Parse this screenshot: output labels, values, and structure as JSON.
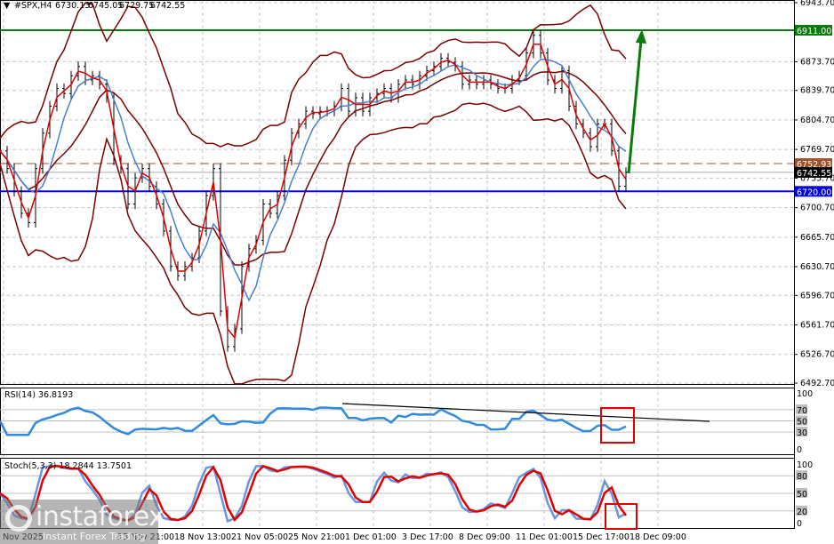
{
  "header": {
    "symbol": "#SPX,H4",
    "open": "6730.13",
    "high": "6745.05",
    "low": "6729.75",
    "close": "6742.55"
  },
  "colors": {
    "bull_bear_bars": "#000000",
    "fast_ma": "#e00000",
    "slow_ma": "#4a7fd0",
    "bands": "#7a0000",
    "resistance": "#0a7a0a",
    "support": "#0000e0",
    "level_brown": "#a0522d",
    "rsi": "#2f8ae0",
    "stoch_main": "#6a95e0",
    "stoch_signal": "#e00000",
    "highlight_box": "#e00000",
    "arrow": "#0a7a0a"
  },
  "levels": {
    "resistance": {
      "value": 6911.0,
      "label": "6911.00"
    },
    "support": {
      "value": 6720.0,
      "label": "6720.00"
    },
    "brown": {
      "value": 6752.93,
      "label": "6752.93"
    },
    "current": {
      "value": 6742.55,
      "label": "6742.55"
    }
  },
  "indicators": {
    "rsi_label": "RSI(14) 36.8193",
    "stoch_label": "Stoch(5,3,3) 18.2844 13.7501",
    "rsi_ticks": [
      "100",
      "70",
      "50",
      "30",
      "0"
    ],
    "stoch_ticks": [
      "100",
      "80",
      "50",
      "20",
      "0"
    ]
  },
  "logo": {
    "name": "instaforex",
    "tagline": "Instant Forex Trading"
  },
  "chart_data": {
    "type": "line",
    "title": "#SPX,H4",
    "ylim": [
      6492.7,
      6943.7
    ],
    "y_ticks": [
      "6943.70",
      "6873.70",
      "6839.70",
      "6804.70",
      "6769.70",
      "6735.70",
      "6700.70",
      "6665.70",
      "6630.70",
      "6596.70",
      "6561.70",
      "6526.70",
      "6492.70"
    ],
    "x_ticks": [
      "6 Nov 2025",
      "13 Nov 21:00",
      "18 Nov 13:00",
      "21 Nov 05:00",
      "25 Nov 21:00",
      "1 Dec 01:00",
      "3 Dec 17:00",
      "8 Dec 09:00",
      "11 Dec 01:00",
      "15 Dec 17:00",
      "18 Dec 09:00"
    ],
    "series": [
      {
        "name": "close",
        "values": [
          6768,
          6747,
          6720,
          6694,
          6683,
          6747,
          6789,
          6821,
          6842,
          6836,
          6857,
          6868,
          6852,
          6857,
          6847,
          6831,
          6757,
          6747,
          6705,
          6736,
          6747,
          6726,
          6705,
          6673,
          6631,
          6620,
          6631,
          6641,
          6673,
          6715,
          6747,
          6578,
          6536,
          6557,
          6631,
          6652,
          6662,
          6705,
          6694,
          6715,
          6757,
          6789,
          6800,
          6815,
          6812,
          6815,
          6815,
          6821,
          6842,
          6815,
          6831,
          6815,
          6831,
          6836,
          6842,
          6831,
          6847,
          6852,
          6847,
          6857,
          6863,
          6868,
          6878,
          6873,
          6868,
          6847,
          6852,
          6847,
          6852,
          6847,
          6842,
          6842,
          6852,
          6857,
          6884,
          6905,
          6884,
          6852,
          6842,
          6863,
          6821,
          6800,
          6789,
          6773,
          6800,
          6800,
          6768,
          6726,
          6742.55
        ]
      }
    ],
    "grid": true
  }
}
